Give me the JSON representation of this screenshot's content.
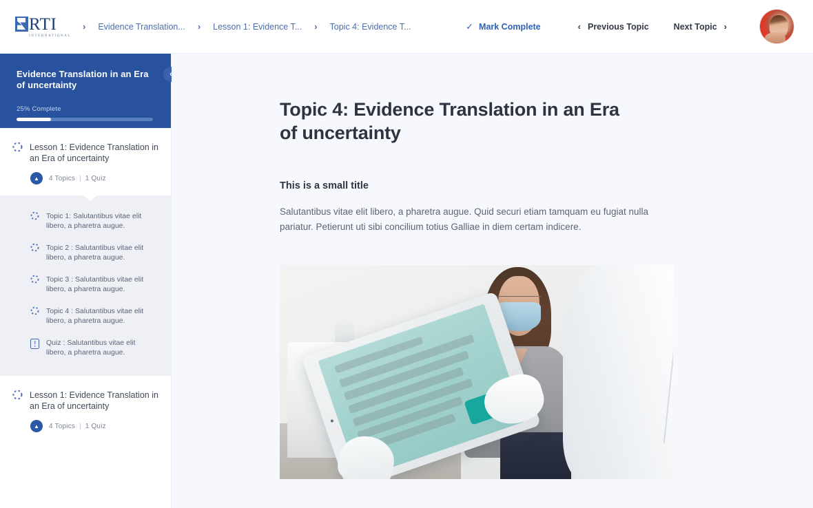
{
  "topbar": {
    "logo": {
      "name": "RTI",
      "subtitle": "INTERNATIONAL"
    },
    "breadcrumbs": [
      {
        "label": "Evidence Translation..."
      },
      {
        "label": "Lesson 1: Evidence T..."
      },
      {
        "label": "Topic 4: Evidence T..."
      }
    ],
    "separator": "›",
    "mark_complete": "Mark Complete",
    "check_glyph": "✓",
    "previous_topic": "Previous Topic",
    "next_topic": "Next Topic",
    "prev_chevron": "‹",
    "next_chevron": "›"
  },
  "sidebar": {
    "course_title": "Evidence Translation in an Era of uncertainty",
    "progress_label": "25% Complete",
    "progress_percent": 25,
    "collapse_glyph": "‹",
    "lessons": [
      {
        "title": "Lesson 1: Evidence Translation in an Era of uncertainty",
        "topics_count": "4 Topics",
        "separator": "|",
        "quiz_count": "1 Quiz",
        "toggle_glyph": "▲",
        "expanded": true,
        "items": [
          {
            "label": "Topic 1: Salutantibus vitae elit libero, a pharetra augue.",
            "icon": "dashed-circle-icon"
          },
          {
            "label": "Topic 2 : Salutantibus vitae elit libero, a pharetra augue.",
            "icon": "dashed-circle-icon"
          },
          {
            "label": "Topic 3 : Salutantibus vitae elit libero, a pharetra augue.",
            "icon": "dashed-circle-icon"
          },
          {
            "label": "Topic 4 : Salutantibus vitae elit libero, a pharetra augue.",
            "icon": "dashed-circle-icon"
          },
          {
            "label": "Quiz : Salutantibus vitae elit libero, a pharetra augue.",
            "icon": "quiz-icon"
          }
        ]
      },
      {
        "title": "Lesson 1: Evidence Translation in an Era of uncertainty",
        "topics_count": "4 Topics",
        "separator": "|",
        "quiz_count": "1 Quiz",
        "toggle_glyph": "▲",
        "expanded": false,
        "items": []
      }
    ]
  },
  "main": {
    "page_title": "Topic 4: Evidence Translation in an Era of uncertainty",
    "small_title": "This is a small title",
    "body_text": "Salutantibus vitae elit libero, a pharetra augue. Quid securi etiam tamquam eu fugiat nulla pariatur. Petierunt uti sibi concilium totius Galliae in diem certam indicere.",
    "photo_alt": "Clinician in white coat holding a tablet with a teal questionnaire in front of a masked seated patient"
  },
  "colors": {
    "brand_blue": "#28519e",
    "link_blue": "#2f62b5",
    "sidebar_panel": "#eef0f5",
    "main_bg": "#f6f8fe",
    "text_dark": "#2d3440",
    "text_muted": "#5c6472"
  }
}
